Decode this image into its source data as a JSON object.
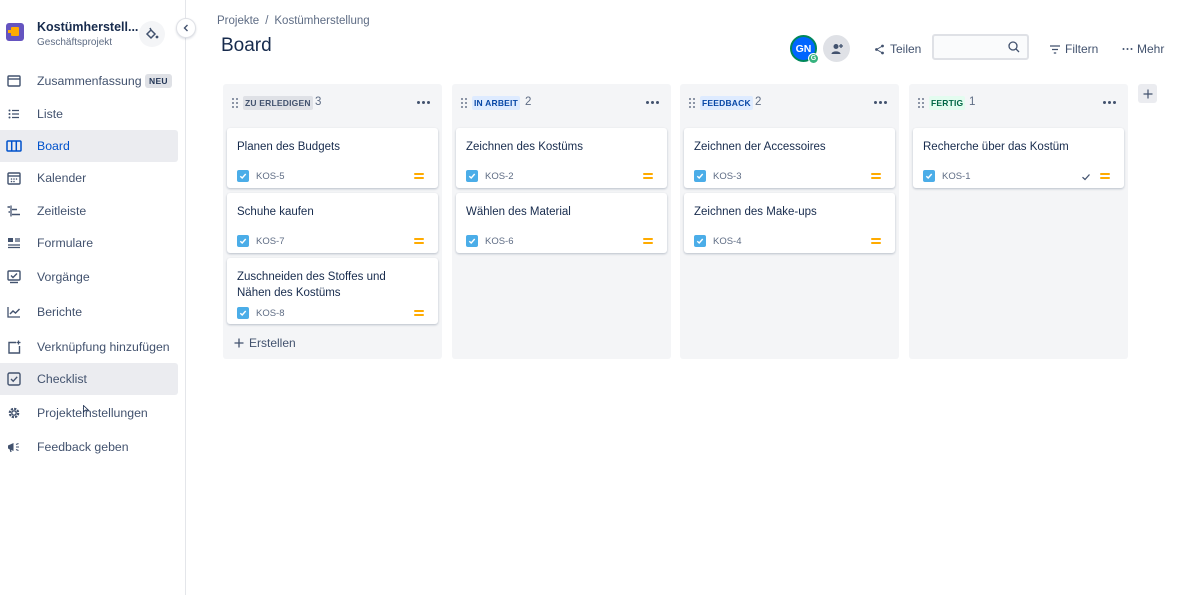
{
  "project": {
    "name": "Kostümherstell...",
    "type": "Geschäftsprojekt"
  },
  "nav": [
    {
      "label": "Zusammenfassung",
      "icon": "summary-icon",
      "badge": "NEU",
      "selected": false
    },
    {
      "label": "Liste",
      "icon": "list-icon",
      "selected": false
    },
    {
      "label": "Board",
      "icon": "board-icon",
      "selected": true
    },
    {
      "label": "Kalender",
      "icon": "calendar-icon",
      "selected": false
    },
    {
      "label": "Zeitleiste",
      "icon": "timeline-icon",
      "selected": false
    },
    {
      "label": "Formulare",
      "icon": "forms-icon",
      "selected": false
    },
    {
      "label": "Vorgänge",
      "icon": "issues-icon",
      "selected": false
    },
    {
      "label": "Berichte",
      "icon": "reports-icon",
      "selected": false
    },
    {
      "label": "Verknüpfung hinzufügen",
      "icon": "add-link-icon",
      "selected": false
    },
    {
      "label": "Checklist",
      "icon": "checklist-icon",
      "selected": true
    },
    {
      "label": "Projekteinstellungen",
      "icon": "settings-icon",
      "selected": false
    },
    {
      "label": "Feedback geben",
      "icon": "megaphone-icon",
      "selected": false
    }
  ],
  "breadcrumb": {
    "root": "Projekte",
    "separator": "/",
    "current": "Kostümherstellung"
  },
  "page_title": "Board",
  "header": {
    "avatar_initials": "GN",
    "avatar_sub": "G",
    "share_label": "Teilen",
    "search_value": "",
    "search_placeholder": "",
    "filter_label": "Filtern",
    "more_label": "Mehr"
  },
  "colors": {
    "accent": "#0052cc",
    "priority_medium": "#ffab00",
    "task_blue": "#4bade8",
    "done_green": "#006644"
  },
  "columns": [
    {
      "title": "ZU ERLEDIGEN",
      "count": "3",
      "badge_bg": "#dfe1e6",
      "badge_fg": "#42526e",
      "cards": [
        {
          "title": "Planen des Budgets",
          "key": "KOS-5",
          "done": false
        },
        {
          "title": "Schuhe kaufen",
          "key": "KOS-7",
          "done": false
        },
        {
          "title": "Zuschneiden des Stoffes und Nähen des Kostüms",
          "key": "KOS-8",
          "done": false
        }
      ],
      "create_label": "Erstellen"
    },
    {
      "title": "IN ARBEIT",
      "count": "2",
      "badge_bg": "#deebff",
      "badge_fg": "#0747a6",
      "cards": [
        {
          "title": "Zeichnen des Kostüms",
          "key": "KOS-2",
          "done": false
        },
        {
          "title": "Wählen des Material",
          "key": "KOS-6",
          "done": false
        }
      ]
    },
    {
      "title": "FEEDBACK",
      "count": "2",
      "badge_bg": "#deebff",
      "badge_fg": "#0747a6",
      "cards": [
        {
          "title": "Zeichnen der Accessoires",
          "key": "KOS-3",
          "done": false
        },
        {
          "title": "Zeichnen des Make-ups",
          "key": "KOS-4",
          "done": false
        }
      ]
    },
    {
      "title": "FERTIG",
      "count": "1",
      "badge_bg": "#e3fcef",
      "badge_fg": "#006644",
      "cards": [
        {
          "title": "Recherche über das Kostüm",
          "key": "KOS-1",
          "done": true
        }
      ]
    }
  ]
}
